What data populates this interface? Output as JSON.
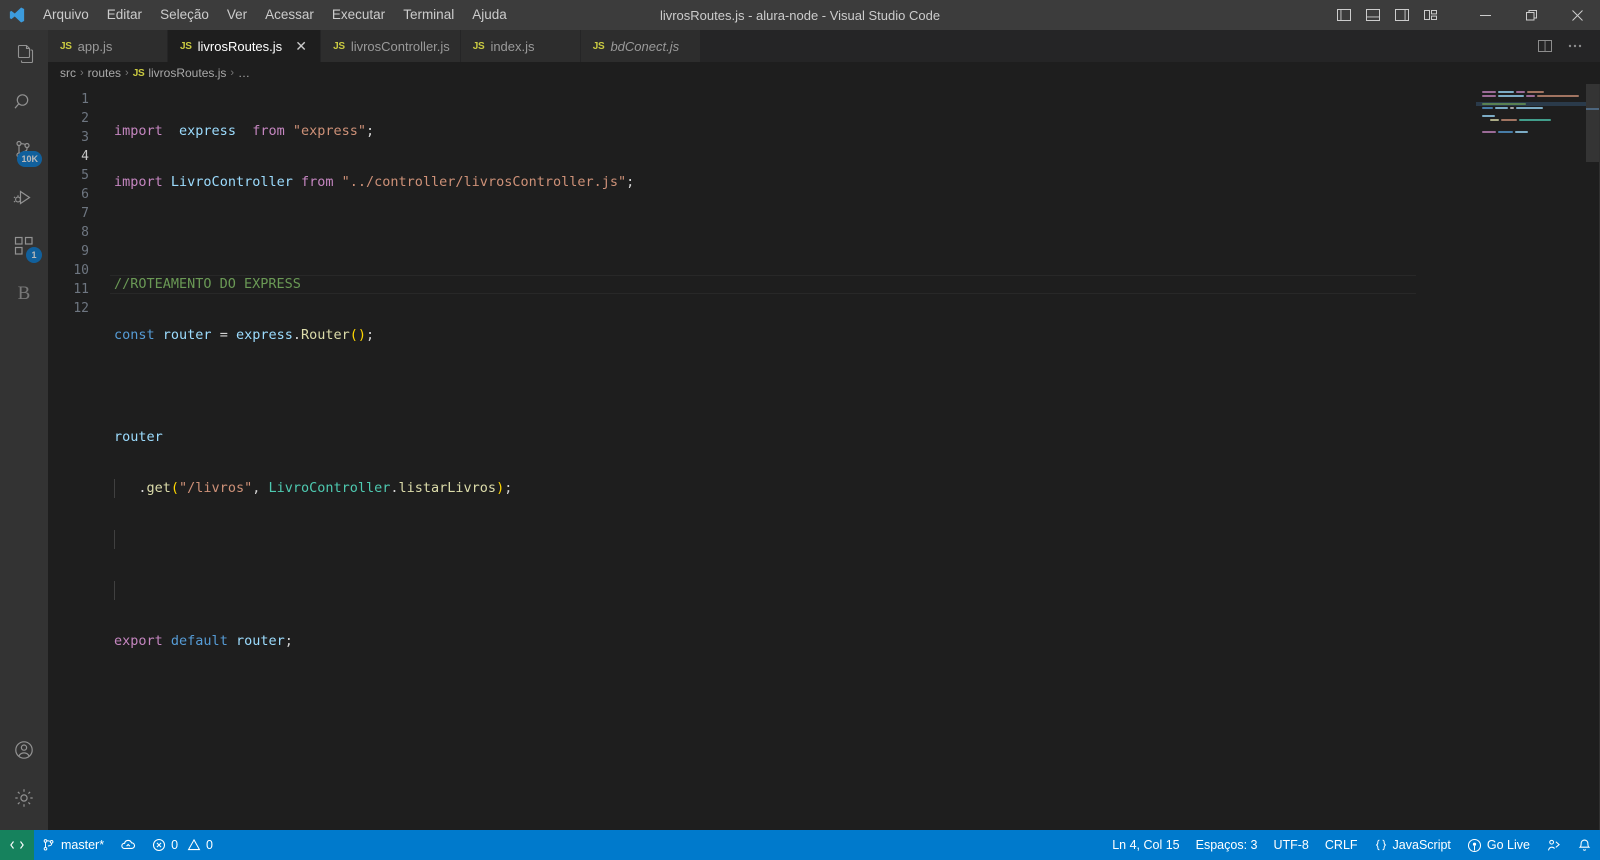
{
  "titlebar": {
    "logo_icon": "vscode-logo-icon",
    "title": "livrosRoutes.js - alura-node - Visual Studio Code",
    "menus": [
      {
        "label": "Arquivo"
      },
      {
        "label": "Editar"
      },
      {
        "label": "Seleção"
      },
      {
        "label": "Ver"
      },
      {
        "label": "Acessar"
      },
      {
        "label": "Executar"
      },
      {
        "label": "Terminal"
      },
      {
        "label": "Ajuda"
      }
    ],
    "layout_icons": [
      {
        "name": "toggle-primary-sidebar-icon"
      },
      {
        "name": "toggle-panel-icon"
      },
      {
        "name": "toggle-secondary-sidebar-icon"
      },
      {
        "name": "customize-layout-icon"
      }
    ],
    "window_controls": [
      {
        "name": "minimize-button",
        "glyph": "─"
      },
      {
        "name": "maximize-button",
        "glyph": "❐"
      },
      {
        "name": "close-button",
        "glyph": "✕"
      }
    ]
  },
  "activitybar": {
    "items": [
      {
        "name": "explorer",
        "icon": "files-icon",
        "badge": "",
        "active": false
      },
      {
        "name": "search",
        "icon": "search-icon",
        "badge": "",
        "active": false
      },
      {
        "name": "source-control",
        "icon": "source-control-icon",
        "badge": "10K",
        "active": false
      },
      {
        "name": "run-and-debug",
        "icon": "run-and-debug-icon",
        "badge": "",
        "active": false
      },
      {
        "name": "extensions",
        "icon": "extensions-icon",
        "badge": "1",
        "active": false
      },
      {
        "name": "bootstrap",
        "icon": "letter-b-icon",
        "badge": "",
        "active": false,
        "letter": "B"
      }
    ],
    "bottom_items": [
      {
        "name": "accounts",
        "icon": "account-icon"
      },
      {
        "name": "manage-settings",
        "icon": "gear-icon"
      }
    ]
  },
  "tabs": [
    {
      "label": "app.js",
      "icon": "js-file-icon",
      "icon_text": "JS",
      "active": false,
      "preview": false,
      "closable": false
    },
    {
      "label": "livrosRoutes.js",
      "icon": "js-file-icon",
      "icon_text": "JS",
      "active": true,
      "preview": false,
      "closable": true
    },
    {
      "label": "livrosController.js",
      "icon": "js-file-icon",
      "icon_text": "JS",
      "active": false,
      "preview": false,
      "closable": false
    },
    {
      "label": "index.js",
      "icon": "js-file-icon",
      "icon_text": "JS",
      "active": false,
      "preview": false,
      "closable": false
    },
    {
      "label": "bdConect.js",
      "icon": "js-file-icon",
      "icon_text": "JS",
      "active": false,
      "preview": true,
      "closable": false
    }
  ],
  "tabbar_actions": [
    {
      "name": "split-editor-right-button",
      "icon": "split-editor-icon"
    },
    {
      "name": "more-actions-button",
      "icon": "ellipsis-icon",
      "glyph": "⋯"
    }
  ],
  "breadcrumbs": {
    "items": [
      {
        "label": "src",
        "icon": ""
      },
      {
        "label": "routes",
        "icon": ""
      },
      {
        "label": "livrosRoutes.js",
        "icon": "js-file-icon",
        "icon_text": "JS"
      },
      {
        "label": "…",
        "icon": ""
      }
    ],
    "separator": "›"
  },
  "editor": {
    "language": "JavaScript",
    "current_line": 4,
    "total_lines": 12,
    "line_numbers": [
      "1",
      "2",
      "3",
      "4",
      "5",
      "6",
      "7",
      "8",
      "9",
      "10",
      "11",
      "12"
    ],
    "code_lines": [
      {
        "n": 1,
        "text": "import  express  from \"express\";"
      },
      {
        "n": 2,
        "text": "import LivroController from \"../controller/livrosController.js\";"
      },
      {
        "n": 3,
        "text": ""
      },
      {
        "n": 4,
        "text": "//ROTEAMENTO DO EXPRESS"
      },
      {
        "n": 5,
        "text": "const router = express.Router();"
      },
      {
        "n": 6,
        "text": ""
      },
      {
        "n": 7,
        "text": "router"
      },
      {
        "n": 8,
        "text": "   .get(\"/livros\", LivroController.listarLivros);"
      },
      {
        "n": 9,
        "text": ""
      },
      {
        "n": 10,
        "text": ""
      },
      {
        "n": 11,
        "text": "export default router;"
      },
      {
        "n": 12,
        "text": ""
      }
    ],
    "tokens": {
      "l1": [
        {
          "t": "import",
          "c": "t-kw"
        },
        {
          "t": "  ",
          "c": "t-punc"
        },
        {
          "t": "express",
          "c": "t-var"
        },
        {
          "t": "  ",
          "c": "t-punc"
        },
        {
          "t": "from",
          "c": "t-kw"
        },
        {
          "t": " ",
          "c": "t-punc"
        },
        {
          "t": "\"express\"",
          "c": "t-str"
        },
        {
          "t": ";",
          "c": "t-punc"
        }
      ],
      "l2": [
        {
          "t": "import",
          "c": "t-kw"
        },
        {
          "t": " ",
          "c": "t-punc"
        },
        {
          "t": "LivroController",
          "c": "t-var"
        },
        {
          "t": " ",
          "c": "t-punc"
        },
        {
          "t": "from",
          "c": "t-kw"
        },
        {
          "t": " ",
          "c": "t-punc"
        },
        {
          "t": "\"../controller/livrosController.js\"",
          "c": "t-str"
        },
        {
          "t": ";",
          "c": "t-punc"
        }
      ],
      "l4": [
        {
          "t": "//ROTEAMENTO DO EXPRESS",
          "c": "t-comment"
        }
      ],
      "l5": [
        {
          "t": "const",
          "c": "t-kw2"
        },
        {
          "t": " ",
          "c": "t-punc"
        },
        {
          "t": "router",
          "c": "t-var"
        },
        {
          "t": " = ",
          "c": "t-op"
        },
        {
          "t": "express",
          "c": "t-var"
        },
        {
          "t": ".",
          "c": "t-punc"
        },
        {
          "t": "Router",
          "c": "t-fn"
        },
        {
          "t": "()",
          "c": "t-paren"
        },
        {
          "t": ";",
          "c": "t-punc"
        }
      ],
      "l7": [
        {
          "t": "router",
          "c": "t-var"
        }
      ],
      "l8": [
        {
          "t": "   .",
          "c": "t-punc"
        },
        {
          "t": "get",
          "c": "t-fn"
        },
        {
          "t": "(",
          "c": "t-paren"
        },
        {
          "t": "\"/livros\"",
          "c": "t-str"
        },
        {
          "t": ", ",
          "c": "t-punc"
        },
        {
          "t": "LivroController",
          "c": "t-cls"
        },
        {
          "t": ".",
          "c": "t-punc"
        },
        {
          "t": "listarLivros",
          "c": "t-fn"
        },
        {
          "t": ")",
          "c": "t-paren"
        },
        {
          "t": ";",
          "c": "t-punc"
        }
      ],
      "l11": [
        {
          "t": "export",
          "c": "t-kw"
        },
        {
          "t": " ",
          "c": "t-punc"
        },
        {
          "t": "default",
          "c": "t-kw2"
        },
        {
          "t": " ",
          "c": "t-punc"
        },
        {
          "t": "router",
          "c": "t-var"
        },
        {
          "t": ";",
          "c": "t-punc"
        }
      ]
    }
  },
  "statusbar": {
    "left": [
      {
        "name": "remote-indicator",
        "icon": "remote-icon",
        "label": ""
      },
      {
        "name": "git-branch",
        "icon": "git-branch-icon",
        "label": "master*"
      },
      {
        "name": "sync-changes",
        "icon": "sync-cloud-icon",
        "label": ""
      },
      {
        "name": "problems",
        "icon": "error-warning-icon",
        "label": "0  0",
        "errors": "0",
        "warnings": "0"
      }
    ],
    "right": [
      {
        "name": "editor-position",
        "label": "Ln 4, Col 15"
      },
      {
        "name": "indentation",
        "label": "Espaços: 3"
      },
      {
        "name": "encoding",
        "label": "UTF-8"
      },
      {
        "name": "eol",
        "label": "CRLF"
      },
      {
        "name": "language-mode",
        "label": "JavaScript",
        "icon": "braces-icon"
      },
      {
        "name": "go-live",
        "label": "Go Live",
        "icon": "broadcast-icon"
      },
      {
        "name": "feedback",
        "label": "",
        "icon": "feedback-icon"
      },
      {
        "name": "notifications",
        "label": "",
        "icon": "bell-icon"
      }
    ]
  },
  "colors": {
    "titlebar_bg": "#3c3c3c",
    "activitybar_bg": "#333333",
    "tabbar_bg": "#252526",
    "editor_bg": "#1e1e1e",
    "statusbar_bg": "#007acc",
    "accent": "#0078d4",
    "badge_bg": "#0078d4",
    "keyword": "#c586c0",
    "keyword2": "#569cd6",
    "variable": "#9cdcfe",
    "string": "#ce9178",
    "comment": "#6a9955",
    "function": "#dcdcaa",
    "class": "#4ec9b0",
    "js_icon": "#cbcb41"
  }
}
